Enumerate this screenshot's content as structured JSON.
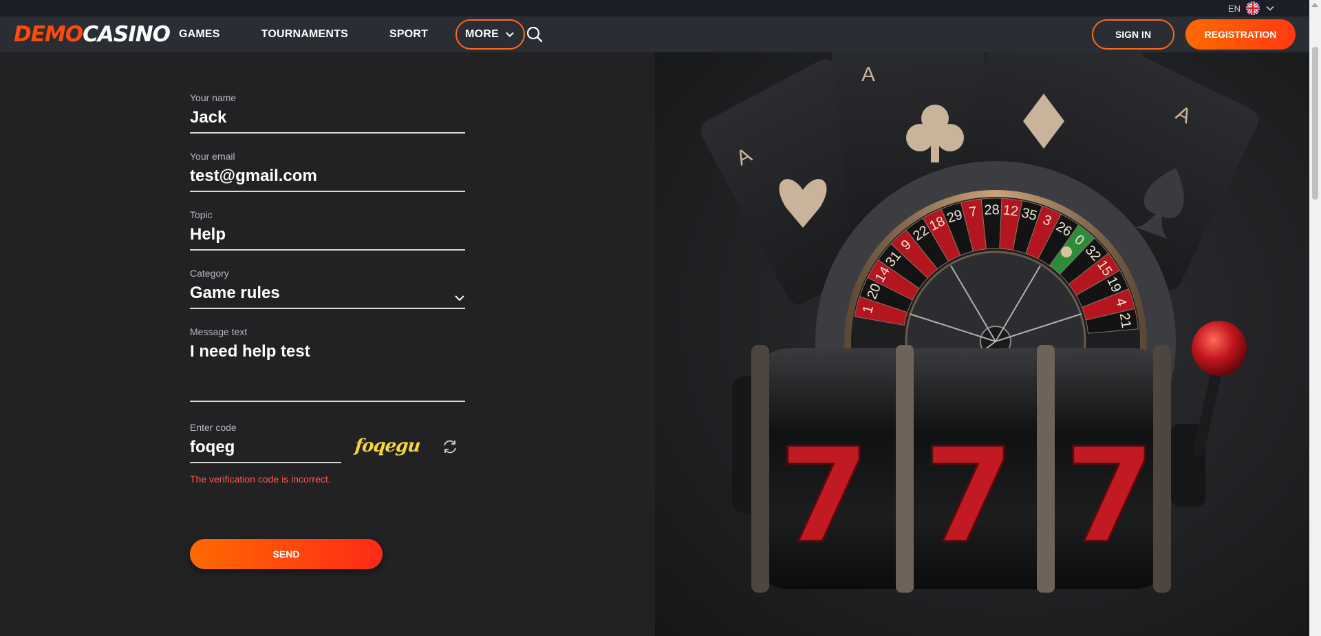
{
  "header": {
    "logo": {
      "part1": "DEMO",
      "part2": "CASINO"
    },
    "nav": [
      "GAMES",
      "TOURNAMENTS",
      "SPORT",
      "MORE"
    ],
    "signin_label": "SIGN IN",
    "registration_label": "REGISTRATION",
    "language": "EN"
  },
  "form": {
    "name": {
      "label": "Your name",
      "value": "Jack"
    },
    "email": {
      "label": "Your email",
      "value": "test@gmail.com"
    },
    "topic": {
      "label": "Topic",
      "value": "Help"
    },
    "category": {
      "label": "Category",
      "value": "Game rules"
    },
    "message": {
      "label": "Message text",
      "value": "I need help test"
    },
    "code": {
      "label": "Enter code",
      "value": "foqeg",
      "captcha": "foqegu",
      "error": "The verification code is incorrect."
    },
    "send_label": "SEND"
  },
  "art": {
    "cards": [
      "A",
      "A",
      "A"
    ],
    "roulette_numbers": [
      "1",
      "20",
      "14",
      "31",
      "9",
      "22",
      "18",
      "29",
      "7",
      "28",
      "12",
      "35",
      "3",
      "26",
      "0",
      "32",
      "15",
      "19",
      "4",
      "21"
    ],
    "reels": [
      "7",
      "7",
      "7"
    ]
  },
  "colors": {
    "accent": "#ff6a1a",
    "error": "#ff5a4a",
    "captcha": "#f4d63a",
    "background": "#222224"
  }
}
